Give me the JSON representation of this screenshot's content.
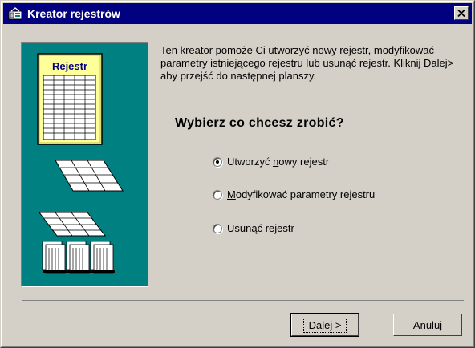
{
  "window": {
    "title": "Kreator rejestrów"
  },
  "picture": {
    "sheet_label": "Rejestr"
  },
  "intro_text": "Ten kreator pomoże Ci utworzyć nowy rejestr, modyfikować parametry istniejącego rejestru lub usunąć rejestr. Kliknij Dalej> aby przejść do następnej planszy.",
  "question": "Wybierz co chcesz zrobić?",
  "options": [
    {
      "pre": "Utworzyć ",
      "key": "n",
      "post": "owy rejestr",
      "selected": true
    },
    {
      "pre": "",
      "key": "M",
      "post": "odyfikować parametry rejestru",
      "selected": false
    },
    {
      "pre": "",
      "key": "U",
      "post": "sunąć rejestr",
      "selected": false
    }
  ],
  "buttons": {
    "next": "Dalej >",
    "cancel": "Anuluj"
  },
  "colors": {
    "titlebar": "#000080",
    "picture_bg": "#008080",
    "sheet_bg": "#ffff99",
    "dialog_bg": "#d4d0c8"
  }
}
